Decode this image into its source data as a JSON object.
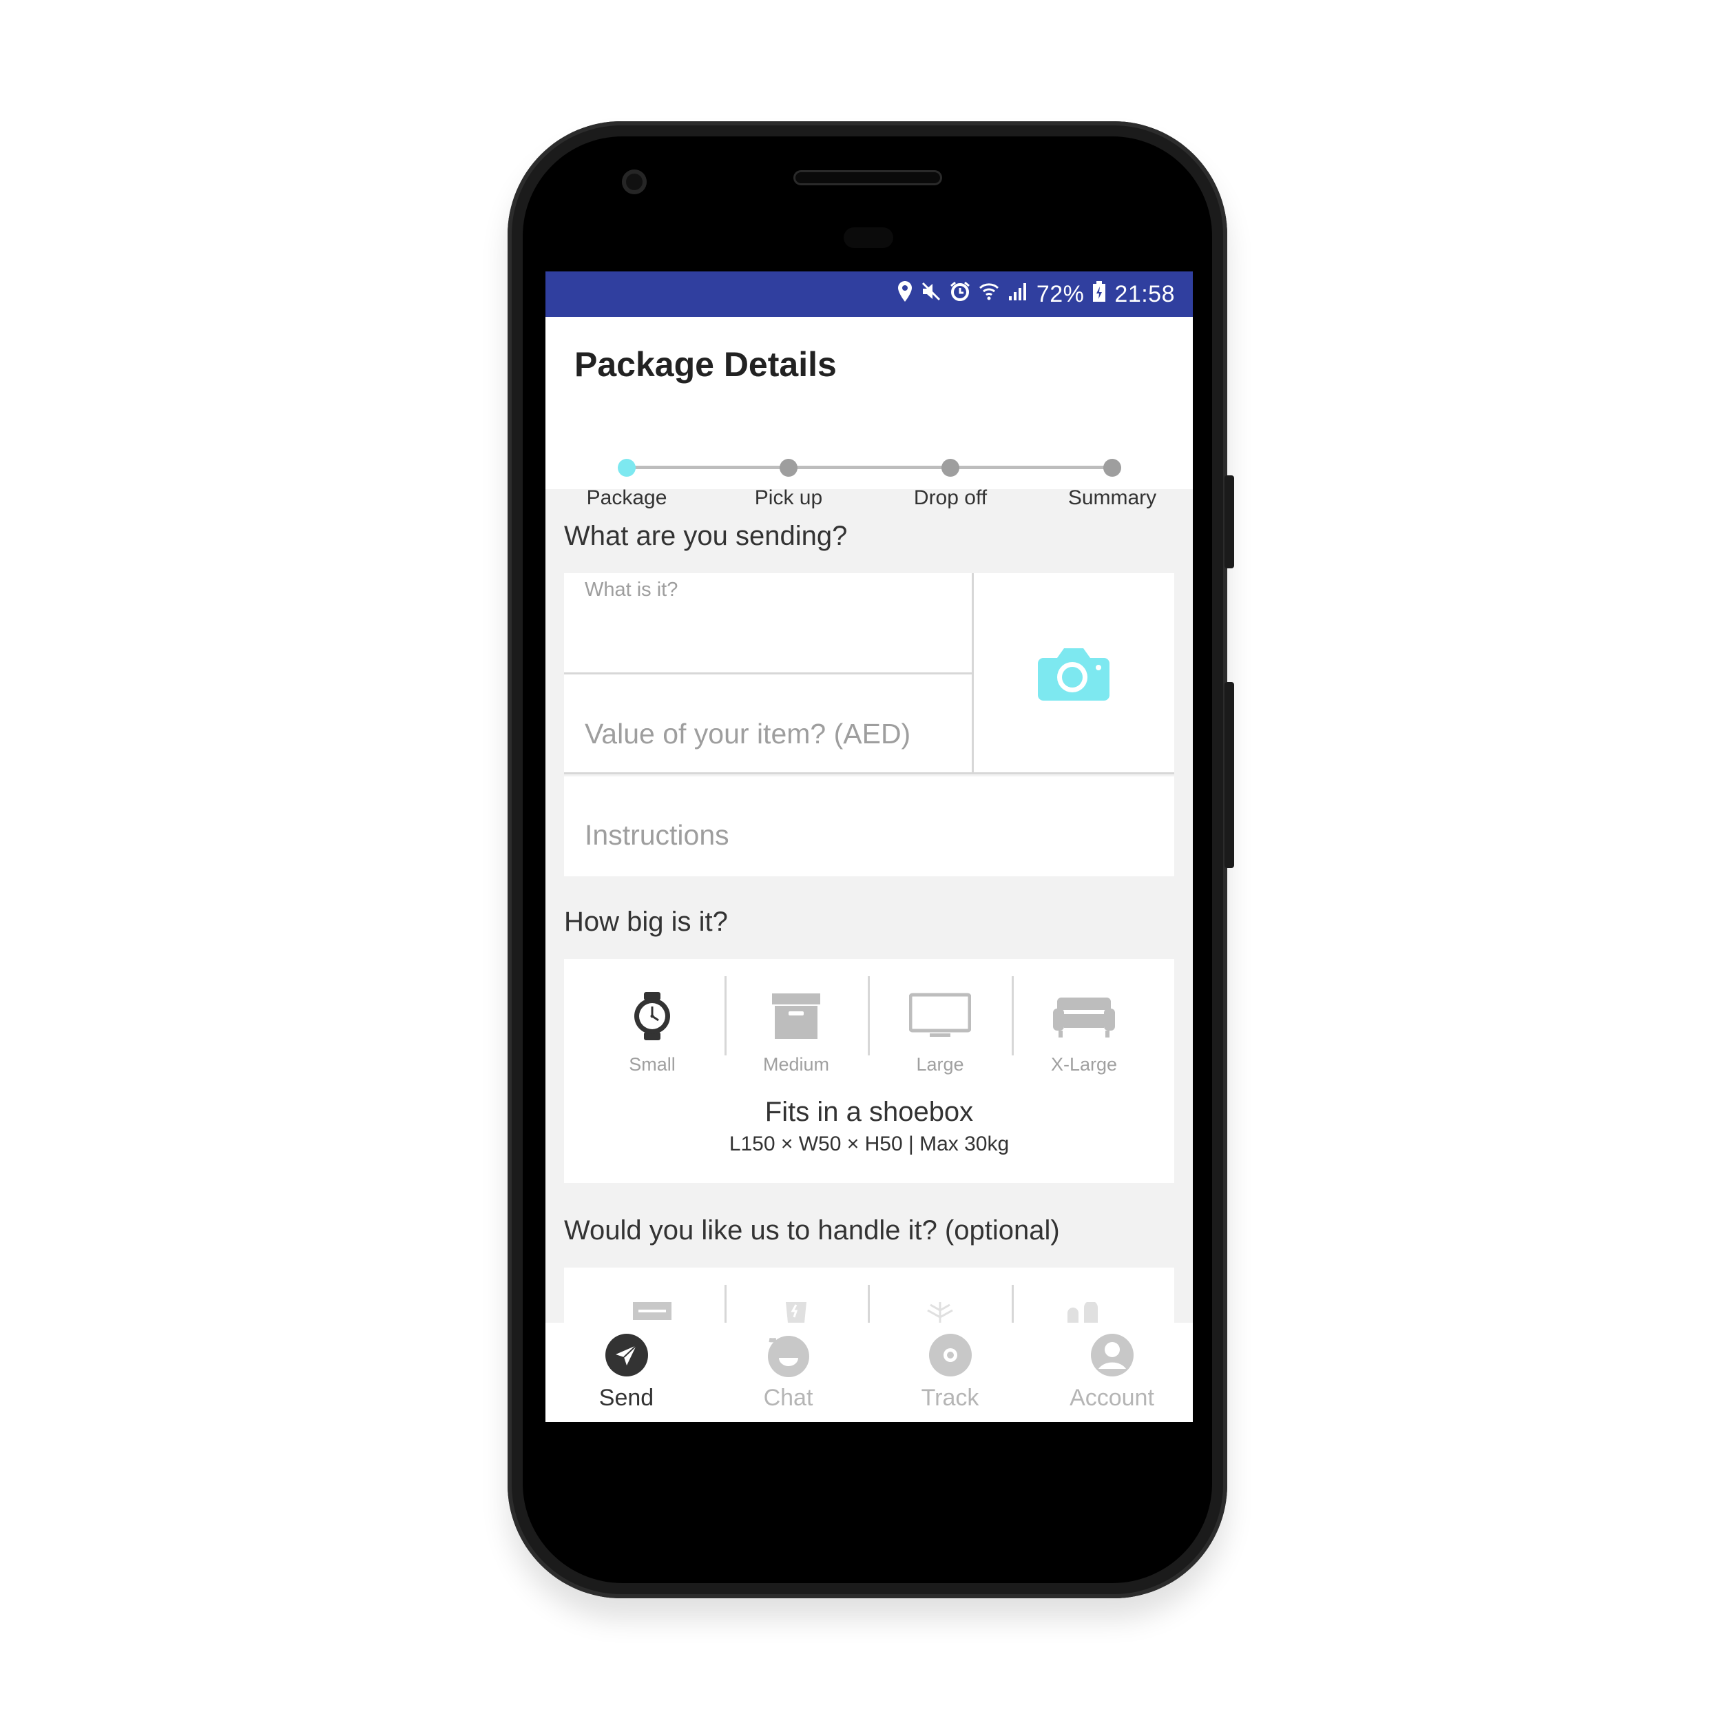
{
  "status_bar": {
    "icons": [
      "location-icon",
      "mute-icon",
      "alarm-icon",
      "wifi-icon",
      "signal-icon",
      "battery-icon"
    ],
    "battery": "72%",
    "time": "21:58",
    "background": "#303f9f"
  },
  "header": {
    "title": "Package Details"
  },
  "stepper": {
    "active_color": "#7de8f0",
    "active_index": 0,
    "steps": [
      {
        "label": "Package"
      },
      {
        "label": "Pick up"
      },
      {
        "label": "Drop off"
      },
      {
        "label": "Summary"
      }
    ]
  },
  "sending": {
    "title": "What are you sending?",
    "what_placeholder": "What is it?",
    "value_placeholder": "Value of your item? (AED)",
    "instructions_placeholder": "Instructions",
    "camera_icon": "camera-icon",
    "camera_color": "#7de8f0"
  },
  "size": {
    "title": "How big is it?",
    "options": [
      {
        "label": "Small",
        "icon": "watch-icon"
      },
      {
        "label": "Medium",
        "icon": "box-icon"
      },
      {
        "label": "Large",
        "icon": "tv-icon"
      },
      {
        "label": "X-Large",
        "icon": "sofa-icon"
      }
    ],
    "selected_index": 0,
    "description": "Fits in a shoebox",
    "dimensions": "L150 × W50 × H50 | Max 30kg"
  },
  "handling": {
    "title": "Would you like us to handle it? (optional)",
    "icons": [
      "wrap-icon",
      "fragile-icon",
      "cold-icon",
      "care-icon"
    ]
  },
  "bottom_nav": {
    "items": [
      {
        "label": "Send",
        "icon": "send-icon"
      },
      {
        "label": "Chat",
        "icon": "chat-icon"
      },
      {
        "label": "Track",
        "icon": "track-icon"
      },
      {
        "label": "Account",
        "icon": "account-icon"
      }
    ],
    "active_index": 0
  }
}
